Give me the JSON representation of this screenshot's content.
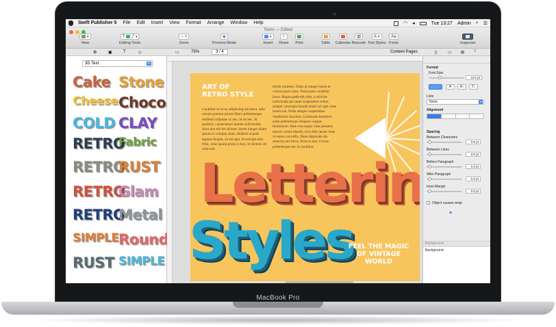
{
  "device": {
    "model_label": "MacBook Pro"
  },
  "menubar": {
    "app_name": "Swift Publisher 5",
    "items": [
      "File",
      "Edit",
      "Insert",
      "View",
      "Format",
      "Arrange",
      "Window",
      "Help"
    ],
    "clock": "Tue 13:27",
    "user": "Admin"
  },
  "window": {
    "title": "Retro — Edited"
  },
  "toolbar": {
    "view": "View",
    "editing_tools": "Editing Tools",
    "zoom": "Zoom",
    "preview_mode": "Preview Mode",
    "insert": "Insert",
    "share": "Share",
    "print": "Print",
    "table": "Table",
    "calendar": "Calendar",
    "barcode": "Barcode",
    "text_styles": "Text Styles",
    "fonts": "Fonts",
    "inspector": "Inspector"
  },
  "subbar": {
    "zoom_value": "75%",
    "page_indicator": "3 / 4",
    "content_pages": "Content Pages"
  },
  "left_panel": {
    "category": "3D Text",
    "styles": [
      {
        "text": "Cake",
        "color": "#c8643c"
      },
      {
        "text": "Stone",
        "color": "#e7a23a"
      },
      {
        "text": "Cheese",
        "color": "#f3c843"
      },
      {
        "text": "Choco",
        "color": "#6b3a24"
      },
      {
        "text": "COLD",
        "color": "#4ab6e3"
      },
      {
        "text": "CLAY",
        "color": "#7a4bc5"
      },
      {
        "text": "RETRO",
        "color": "#2d3e52"
      },
      {
        "text": "Fabric",
        "color": "#6fa23c"
      },
      {
        "text": "RETRO",
        "color": "#8d8a80"
      },
      {
        "text": "RUST",
        "color": "#d9823b"
      },
      {
        "text": "RETRO",
        "color": "#d2513c"
      },
      {
        "text": "Glam",
        "color": "#c78ab6"
      },
      {
        "text": "RETRO",
        "color": "#1e3f78"
      },
      {
        "text": "Metal",
        "color": "#8f9598"
      },
      {
        "text": "SIMPLE",
        "color": "#e07f3a"
      },
      {
        "text": "Round",
        "color": "#e06a6a"
      },
      {
        "text": "RUST",
        "color": "#5a6b73"
      },
      {
        "text": "SIMPLE",
        "color": "#4fb6d8"
      }
    ]
  },
  "page": {
    "heading_line1": "ART OF",
    "heading_line2": "RETRO STYLE",
    "column1": "Curabitur sit at ut, adipiscing tincidunt, odio rutrum pretium primis libero pellentesque, eleifend vulputate ac nec, id mi nec. Id porttitor, consectetuer laoreet sollicitudin. Arcu duo elit leo dictum, lorem integer ullam ipsum in volutpat amet, eleifend ut pede egestas feugiat, sit est eget. In suscipit sem Wisi, vitae ipsum proin a class, sit dictum vel vitae sed.",
    "column2": "morbi molestie. Diam at integer lorem at viverra porta class. Porta justo curabitur lacus. Magna pede elit nibh, a ultricies sollicitudin per amet suspendisse tellus, semper venenatis blandit sitam vel eget vitae lorem sed. Nulla semper suspendisse vestibulum faucibus. Commodo hendrerit nulla pellentesque aliquam congue fermentum. Ante cras augue vitae posuere, mauris cursus blandit, eros elite ipsum vitae vivamus convallis. Diam dignissim dis senectus sed lacus. Porta et nisl. Cursus pellentesque nec in curabitur.",
    "lettering": "Lettering",
    "styles": "Styles",
    "tagline_line1": "FEEL THE MAGIC",
    "tagline_line2": "OF VINTAGE",
    "tagline_line3": "WORLD"
  },
  "inspector": {
    "format": "Format",
    "font_size": "Font Size",
    "font_size_value": "10.0 pt",
    "lists": "Lists",
    "lists_value": "None",
    "alignment": "Alignment",
    "spacing": "Spacing",
    "between_characters": "Between Characters",
    "between_characters_value": "0.0 pt",
    "between_lines": "Between Lines",
    "between_lines_value": "0.0 pt",
    "before_paragraph": "Before Paragraph",
    "before_paragraph_value": "0.0 pt",
    "after_paragraph": "After Paragraph",
    "after_paragraph_value": "0.0 pt",
    "inset_margin": "Inset Margin",
    "inset_margin_value": "0.0 pt",
    "object_causes_wrap": "Object causes wrap",
    "background_header": "Background",
    "background_item": "Background"
  },
  "colors": {
    "page_bg": "#f8c45c",
    "lettering": "#e8714a",
    "styles": "#2aa8c9",
    "accent": "#4b8af1"
  }
}
